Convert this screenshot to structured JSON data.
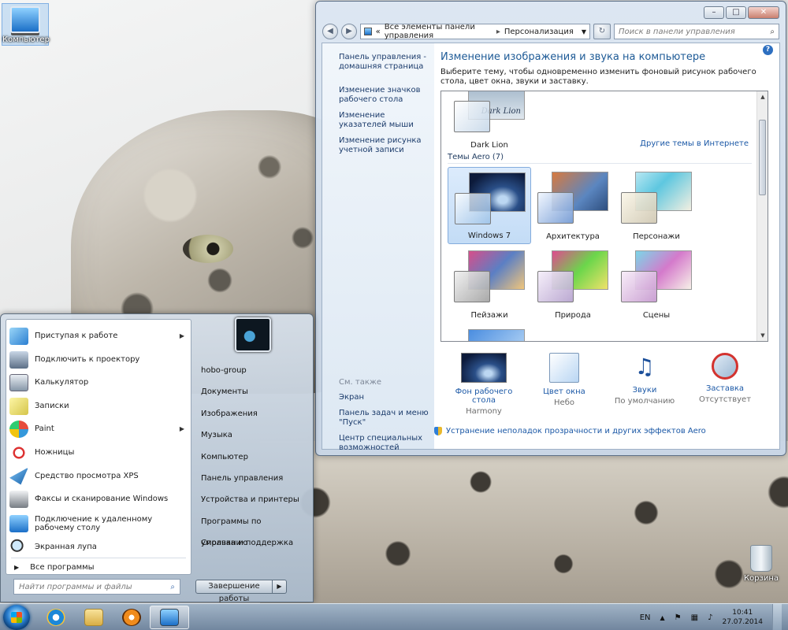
{
  "desktop": {
    "icons": [
      {
        "label": "Компьютер"
      },
      {
        "label": "Корзина"
      }
    ]
  },
  "window": {
    "breadcrumb": [
      "Все элементы панели управления",
      "Персонализация"
    ],
    "search_placeholder": "Поиск в панели управления",
    "sidebar_links": [
      "Панель управления - домашняя страница",
      "Изменение значков рабочего стола",
      "Изменение указателей мыши",
      "Изменение рисунка учетной записи"
    ],
    "see_also": {
      "heading": "См. также",
      "links": [
        "Экран",
        "Панель задач и меню \"Пуск\"",
        "Центр специальных возможностей"
      ]
    },
    "title": "Изменение изображения и звука на компьютере",
    "subtitle": "Выберите тему, чтобы одновременно изменить фоновый рисунок рабочего стола, цвет окна, звуки и заставку.",
    "more_themes_link": "Другие темы в Интернете",
    "aero_heading": "Темы Aero (7)",
    "top_theme": {
      "label": "Dark Lion",
      "art_text": "Dark Lion"
    },
    "themes": [
      {
        "label": "Windows 7",
        "selected": true
      },
      {
        "label": "Архитектура"
      },
      {
        "label": "Персонажи"
      },
      {
        "label": "Пейзажи"
      },
      {
        "label": "Природа"
      },
      {
        "label": "Сцены"
      }
    ],
    "settings": [
      {
        "label": "Фон рабочего стола",
        "value": "Harmony"
      },
      {
        "label": "Цвет окна",
        "value": "Небо"
      },
      {
        "label": "Звуки",
        "value": "По умолчанию"
      },
      {
        "label": "Заставка",
        "value": "Отсутствует"
      }
    ],
    "troubleshoot_link": "Устранение неполадок прозрачности и других эффектов Aero"
  },
  "start_menu": {
    "programs": [
      {
        "label": "Приступая к работе",
        "submenu": true
      },
      {
        "label": "Подключить к проектору"
      },
      {
        "label": "Калькулятор"
      },
      {
        "label": "Записки"
      },
      {
        "label": "Paint",
        "submenu": true
      },
      {
        "label": "Ножницы"
      },
      {
        "label": "Средство просмотра XPS"
      },
      {
        "label": "Факсы и сканирование Windows"
      },
      {
        "label": "Подключение к удаленному рабочему столу"
      },
      {
        "label": "Экранная лупа"
      }
    ],
    "all_programs": "Все программы",
    "search_placeholder": "Найти программы и файлы",
    "right_items": [
      "hobo-group",
      "Документы",
      "Изображения",
      "Музыка",
      "Компьютер",
      "Панель управления",
      "Устройства и принтеры",
      "Программы по умолчанию",
      "Справка и поддержка"
    ],
    "shutdown_label": "Завершение работы"
  },
  "taskbar": {
    "language": "EN",
    "time": "10:41",
    "date": "27.07.2014"
  },
  "colors": {
    "link": "#1b58a6",
    "title": "#1d5a96",
    "selection": "#c3dcf6"
  }
}
